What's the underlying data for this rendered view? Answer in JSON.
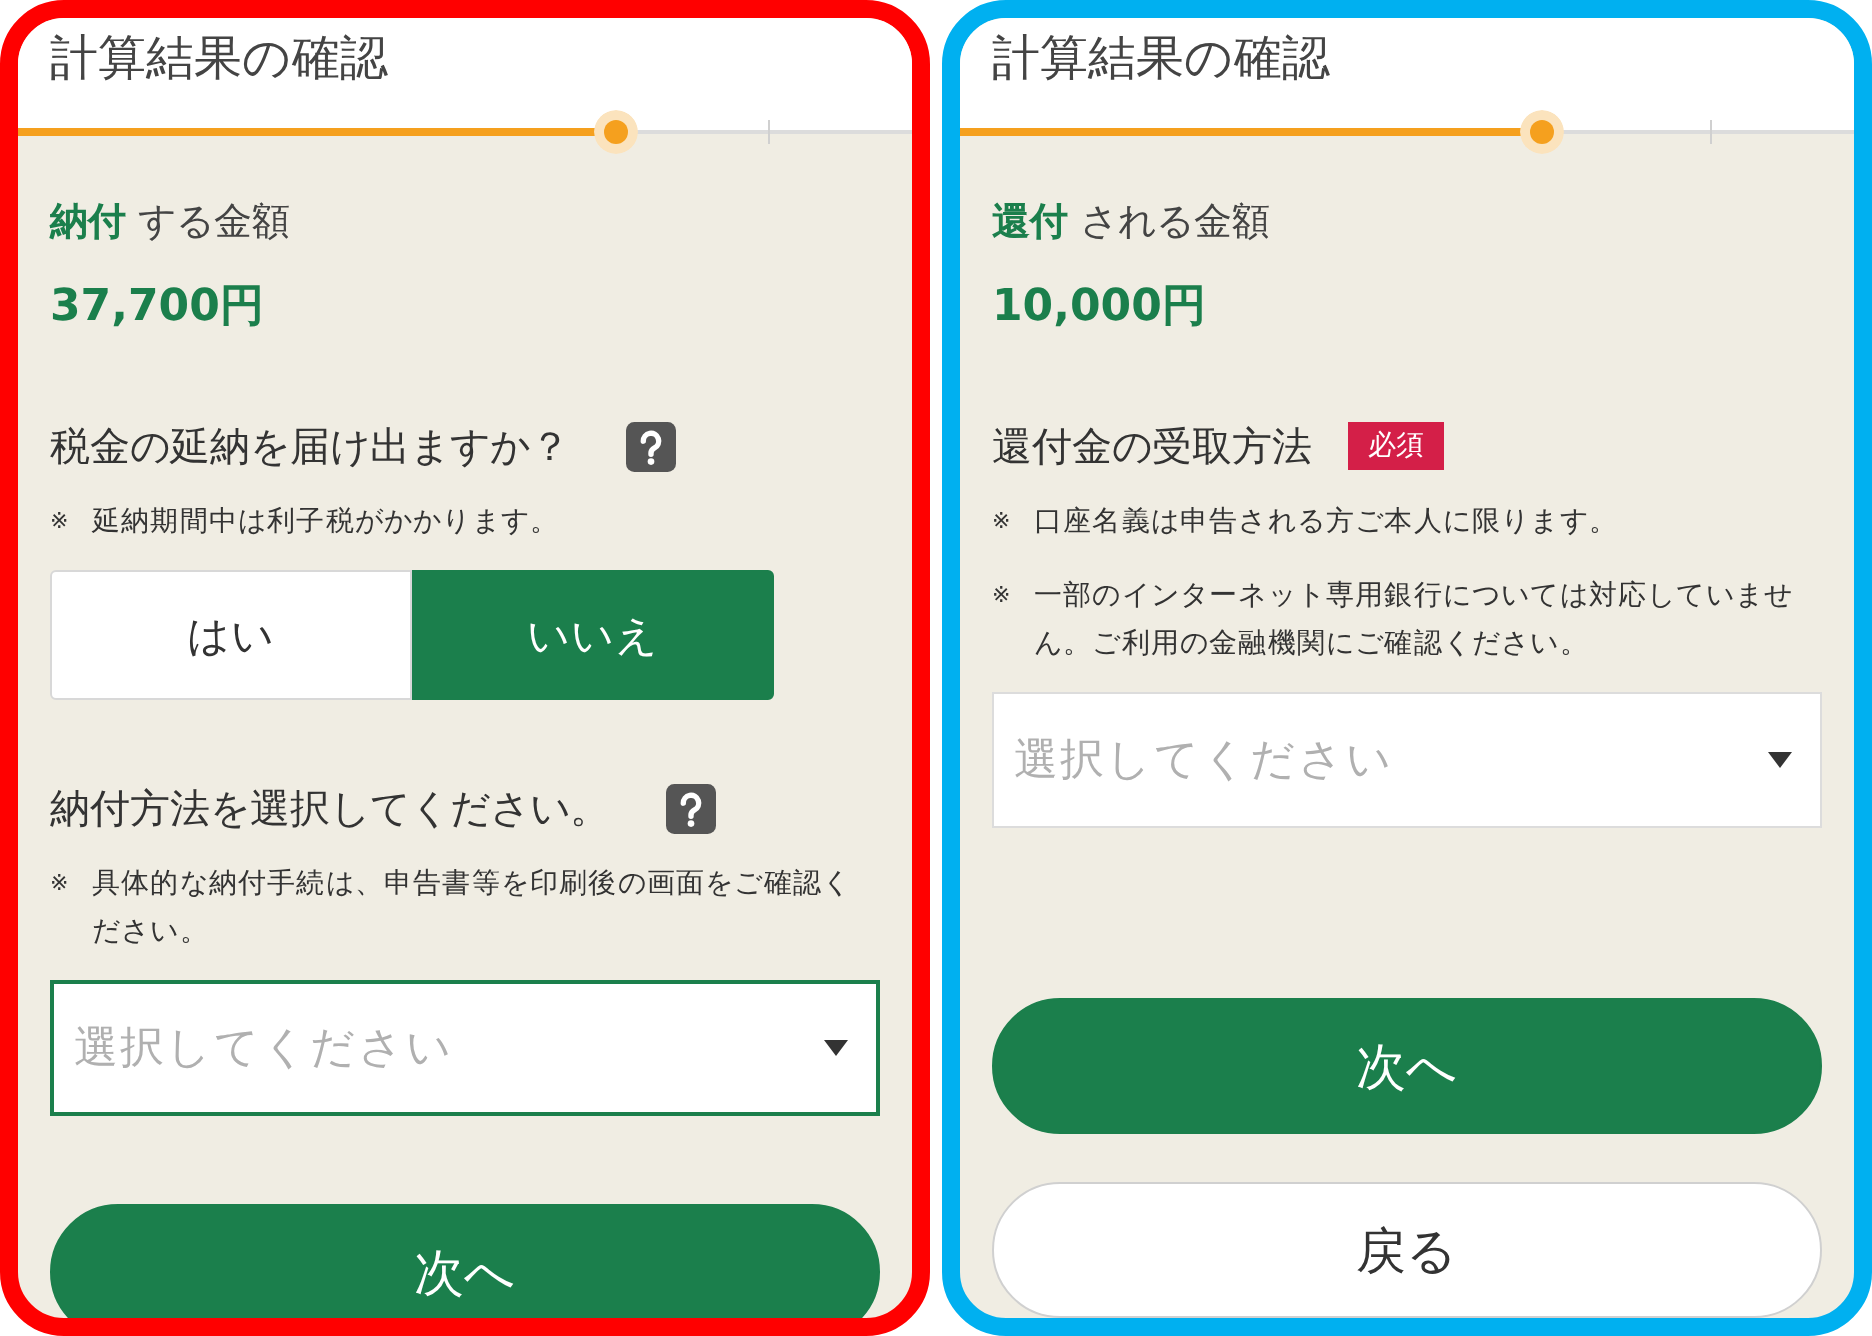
{
  "panels": [
    {
      "color": "#ff0000",
      "title": "計算結果の確認",
      "progress": {
        "level": 0.67
      },
      "amount": {
        "label": "**納付** する金額",
        "value": "37,700円"
      },
      "sections": [
        {
          "kind": "choice",
          "question": "税金の延納を届け出ますか？",
          "help": true,
          "notes": [
            {
              "mark": "※",
              "text": "延納期間中は利子税がかかります。"
            }
          ],
          "options": [
            {
              "label": "はい",
              "selected": false
            },
            {
              "label": "いいえ",
              "selected": true
            }
          ]
        },
        {
          "kind": "select",
          "question": "納付方法を選択してください。",
          "help": true,
          "notes": [
            {
              "mark": "※",
              "text": "具体的な納付手続は、申告書等を印刷後の画面をご確認ください。"
            }
          ],
          "select": {
            "placeholder": "選択してください",
            "focused": true
          }
        }
      ],
      "buttons": [
        {
          "kind": "primary",
          "label": "次へ"
        }
      ]
    },
    {
      "color": "#00b0f0",
      "title": "計算結果の確認",
      "progress": {
        "level": 0.65
      },
      "amount": {
        "label": "**還付** される金額",
        "value": "10,000円"
      },
      "sections": [
        {
          "kind": "select",
          "question": "還付金の受取方法",
          "help": false,
          "badge": "必須",
          "notes": [
            {
              "mark": "※",
              "text": "口座名義は申告される方ご本人に限ります。"
            },
            {
              "mark": "※",
              "text": "一部のインターネット専用銀行については対応していません。ご利用の金融機関にご確認ください。"
            }
          ],
          "select": {
            "placeholder": "選択してください",
            "focused": false
          }
        }
      ],
      "buttons": [
        {
          "kind": "primary",
          "label": "次へ"
        },
        {
          "kind": "secondary",
          "label": "戻る"
        }
      ]
    }
  ]
}
